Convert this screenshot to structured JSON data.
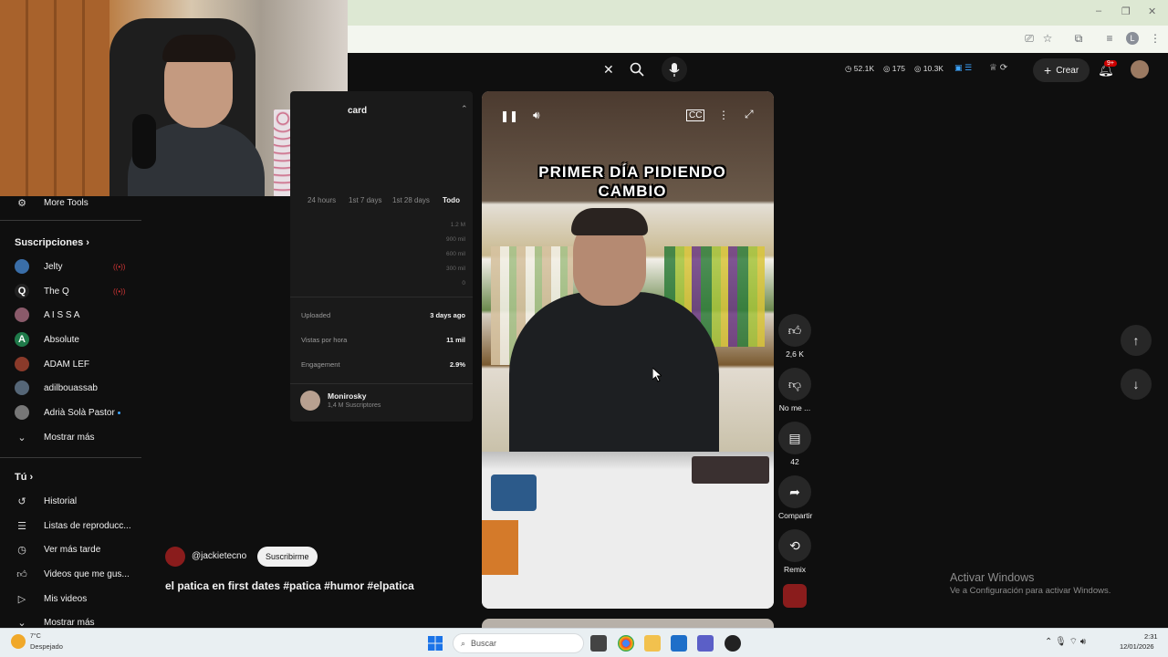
{
  "browser": {
    "window_controls": [
      "–",
      "❐",
      "✕"
    ]
  },
  "youtube_header": {
    "search_close": "✕",
    "counters": [
      {
        "icon": "clock",
        "value": "52.1K"
      },
      {
        "icon": "eye",
        "value": "175"
      },
      {
        "icon": "eye",
        "value": "10.3K"
      }
    ],
    "create_label": "Crear",
    "notification_badge": "9+"
  },
  "sidebar": {
    "more_tools": "More Tools",
    "subs_title": "Suscripciones",
    "subs": [
      {
        "label": "Jelty",
        "live": "((•))",
        "color": "#3a6ea8"
      },
      {
        "label": "The Q",
        "live": "((•))",
        "letter": "Q",
        "color": "#222"
      },
      {
        "label": "A I S S A",
        "color": "#8a5a6a"
      },
      {
        "label": "Absolute",
        "letter": "A",
        "color": "#1f7a4a"
      },
      {
        "label": "ADAM LEF",
        "color": "#8a3a2a"
      },
      {
        "label": "adilbouassab",
        "color": "#556677"
      },
      {
        "label": "Adrià Solà Pastor",
        "color": "#777"
      }
    ],
    "show_more": "Mostrar más",
    "you_title": "Tú",
    "you_items": [
      {
        "label": "Historial",
        "icon": "history-icon"
      },
      {
        "label": "Listas de reproducc...",
        "icon": "playlist-icon"
      },
      {
        "label": "Ver más tarde",
        "icon": "clock-icon"
      },
      {
        "label": "Videos que me gus...",
        "icon": "like-icon"
      },
      {
        "label": "Mis videos",
        "icon": "video-icon"
      }
    ],
    "show_more_2": "Mostrar más"
  },
  "stats": {
    "card_title": "card",
    "tabs": [
      "24 hours",
      "1st 7 days",
      "1st 28 days",
      "Todo"
    ],
    "axis": [
      "1.2 M",
      "900 mil",
      "600 mil",
      "300 mil",
      "0"
    ],
    "rows": [
      {
        "label": "Uploaded",
        "value": "3 days ago"
      },
      {
        "label": "Vistas por hora",
        "value": "11 mil"
      },
      {
        "label": "Engagement",
        "value": "2.9%"
      }
    ],
    "channel_name": "Monirosky",
    "channel_subs": "1,4 M Suscriptores"
  },
  "video": {
    "overlay_title_1": "PRIMER DÍA PIDIENDO",
    "overlay_title_2": "CAMBIO",
    "channel": "@jackietecno",
    "subscribe": "Suscribirme",
    "caption": "el patica en first dates #patica  #humor #elpatica"
  },
  "actions": {
    "likes": "2,6 K",
    "dislike": "No me ...",
    "comments": "42",
    "share": "Compartir",
    "remix": "Remix"
  },
  "windows": {
    "activate_title": "Activar Windows",
    "activate_sub": "Ve a Configuración para activar Windows.",
    "weather_temp": "7°C",
    "weather_desc": "Despejado",
    "search_placeholder": "Buscar",
    "time": "2:31",
    "date": "12/01/2026"
  }
}
